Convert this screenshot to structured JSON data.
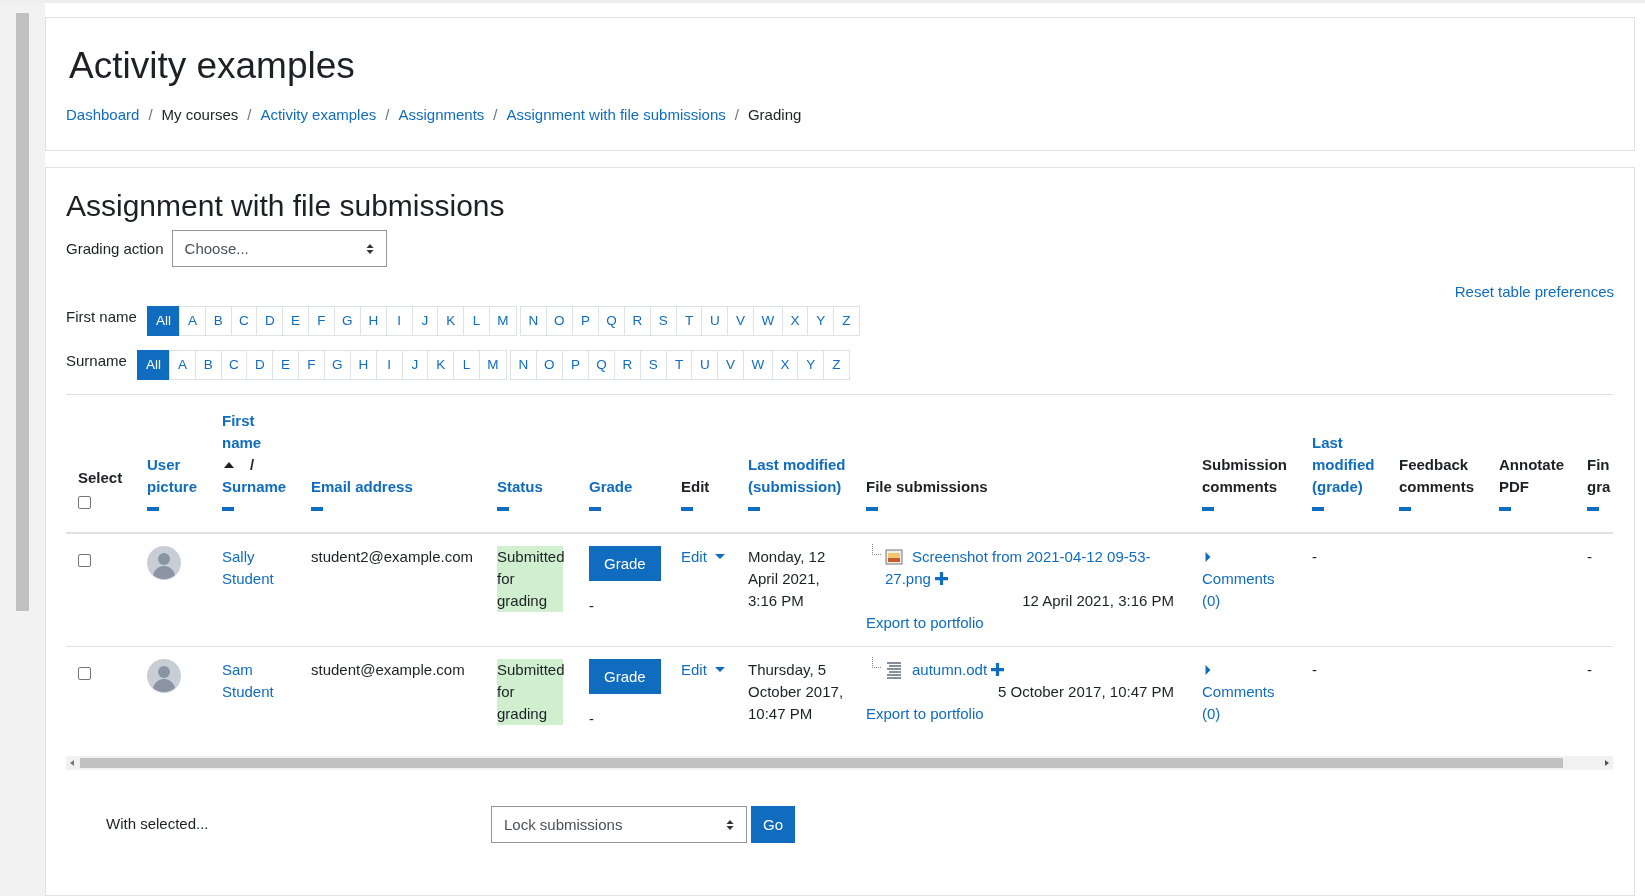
{
  "page_header": {
    "title": "Activity examples",
    "breadcrumb": [
      {
        "label": "Dashboard",
        "link": true
      },
      {
        "separator": "/",
        "label": "My courses",
        "link": false
      },
      {
        "separator": "/",
        "label": "Activity examples",
        "link": true
      },
      {
        "separator": "/",
        "label": "Assignments",
        "link": true
      },
      {
        "separator": "/",
        "label": "Assignment with file submissions",
        "link": true
      },
      {
        "separator": "/",
        "label": "Grading",
        "link": false
      }
    ]
  },
  "assignment": {
    "title": "Assignment with file submissions",
    "grading_action": {
      "label": "Grading action",
      "value": "Choose..."
    },
    "reset_link": "Reset table preferences",
    "initials_bars": [
      {
        "label": "First name",
        "letters": [
          {
            "label": "All",
            "selected": true
          },
          {
            "label": "A",
            "selected": false
          },
          {
            "label": "B",
            "selected": false
          },
          {
            "label": "C",
            "selected": false
          },
          {
            "label": "D",
            "selected": false
          },
          {
            "label": "E",
            "selected": false
          },
          {
            "label": "F",
            "selected": false
          },
          {
            "label": "G",
            "selected": false
          },
          {
            "label": "H",
            "selected": false
          },
          {
            "label": "I",
            "selected": false
          },
          {
            "label": "J",
            "selected": false
          },
          {
            "label": "K",
            "selected": false
          },
          {
            "label": "L",
            "selected": false
          },
          {
            "label": "M",
            "selected": false
          },
          {
            "label": "N",
            "selected": false
          },
          {
            "label": "O",
            "selected": false
          },
          {
            "label": "P",
            "selected": false
          },
          {
            "label": "Q",
            "selected": false
          },
          {
            "label": "R",
            "selected": false
          },
          {
            "label": "S",
            "selected": false
          },
          {
            "label": "T",
            "selected": false
          },
          {
            "label": "U",
            "selected": false
          },
          {
            "label": "V",
            "selected": false
          },
          {
            "label": "W",
            "selected": false
          },
          {
            "label": "X",
            "selected": false
          },
          {
            "label": "Y",
            "selected": false
          },
          {
            "label": "Z",
            "selected": false
          }
        ]
      },
      {
        "label": "Surname",
        "letters": [
          {
            "label": "All",
            "selected": true
          },
          {
            "label": "A",
            "selected": false
          },
          {
            "label": "B",
            "selected": false
          },
          {
            "label": "C",
            "selected": false
          },
          {
            "label": "D",
            "selected": false
          },
          {
            "label": "E",
            "selected": false
          },
          {
            "label": "F",
            "selected": false
          },
          {
            "label": "G",
            "selected": false
          },
          {
            "label": "H",
            "selected": false
          },
          {
            "label": "I",
            "selected": false
          },
          {
            "label": "J",
            "selected": false
          },
          {
            "label": "K",
            "selected": false
          },
          {
            "label": "L",
            "selected": false
          },
          {
            "label": "M",
            "selected": false
          },
          {
            "label": "N",
            "selected": false
          },
          {
            "label": "O",
            "selected": false
          },
          {
            "label": "P",
            "selected": false
          },
          {
            "label": "Q",
            "selected": false
          },
          {
            "label": "R",
            "selected": false
          },
          {
            "label": "S",
            "selected": false
          },
          {
            "label": "T",
            "selected": false
          },
          {
            "label": "U",
            "selected": false
          },
          {
            "label": "V",
            "selected": false
          },
          {
            "label": "W",
            "selected": false
          },
          {
            "label": "X",
            "selected": false
          },
          {
            "label": "Y",
            "selected": false
          },
          {
            "label": "Z",
            "selected": false
          }
        ]
      }
    ],
    "table": {
      "columns": [
        {
          "kind": "select",
          "label": "Select",
          "link": false,
          "checked": false
        },
        {
          "kind": "text",
          "label": "User picture",
          "link": true
        },
        {
          "kind": "name",
          "first": "First name",
          "separator": "/",
          "second": "Surname",
          "sort_ascending": true
        },
        {
          "kind": "text",
          "label": "Email address",
          "link": true
        },
        {
          "kind": "text",
          "label": "Status",
          "link": true
        },
        {
          "kind": "text",
          "label": "Grade",
          "link": true
        },
        {
          "kind": "text",
          "label": "Edit",
          "link": false
        },
        {
          "kind": "text",
          "label": "Last modified (submission)",
          "link": true
        },
        {
          "kind": "text",
          "label": "File submissions",
          "link": false
        },
        {
          "kind": "text",
          "label": "Submission comments",
          "link": false
        },
        {
          "kind": "text",
          "label": "Last modified (grade)",
          "link": true
        },
        {
          "kind": "text",
          "label": "Feedback comments",
          "link": false
        },
        {
          "kind": "text",
          "label": "Annotate PDF",
          "link": false
        },
        {
          "kind": "text",
          "label": "Fin gra",
          "link": false
        }
      ],
      "rows": [
        {
          "checked": false,
          "name": "Sally Student",
          "email": "student2@example.com",
          "status": {
            "label": "Submitted for grading",
            "highlighted": true
          },
          "grade_button": "Grade",
          "grade": "-",
          "edit": "Edit",
          "last_modified": "Monday, 12 April 2021, 3:16 PM",
          "file": {
            "kind": "image",
            "name": "Screenshot from 2021-04-12 09-53-27.png",
            "date": "12 April 2021, 3:16 PM"
          },
          "export": "Export to portfolio",
          "comments": "Comments (0)",
          "last_modified_grade": "-",
          "final_grade": "-"
        },
        {
          "checked": false,
          "name": "Sam Student",
          "email": "student@example.com",
          "status": {
            "label": "Submitted for grading",
            "highlighted": true
          },
          "grade_button": "Grade",
          "grade": "-",
          "edit": "Edit",
          "last_modified": "Thursday, 5 October 2017, 10:47 PM",
          "file": {
            "kind": "document",
            "name": "autumn.odt",
            "date": "5 October 2017, 10:47 PM"
          },
          "export": "Export to portfolio",
          "comments": "Comments (0)",
          "last_modified_grade": "-",
          "final_grade": "-"
        }
      ]
    },
    "with_selected": {
      "label": "With selected...",
      "value": "Lock submissions",
      "button": "Go"
    }
  }
}
